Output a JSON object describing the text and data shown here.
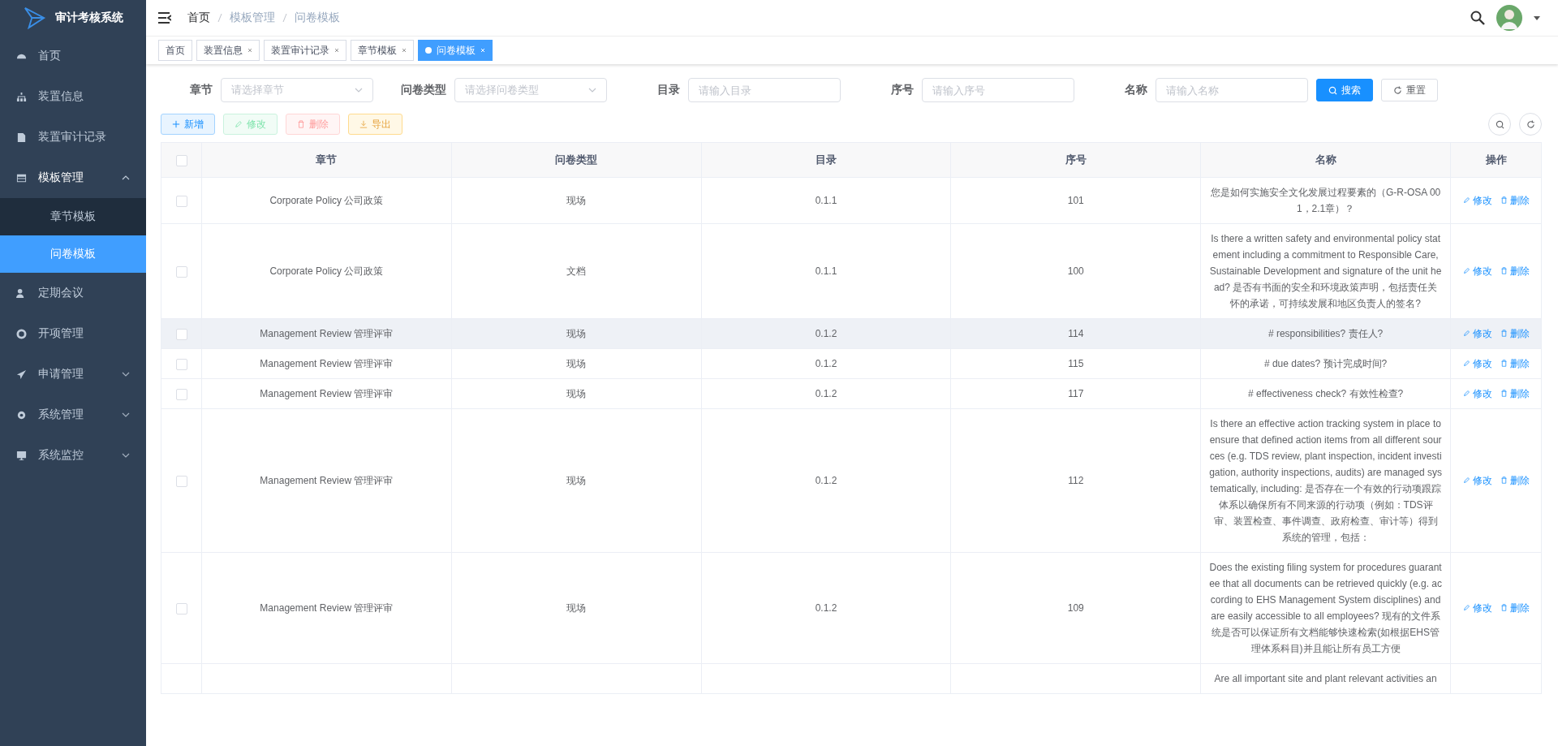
{
  "sidebar": {
    "title": "审计考核系统",
    "items": [
      {
        "label": "首页"
      },
      {
        "label": "装置信息"
      },
      {
        "label": "装置审计记录"
      },
      {
        "label": "模板管理",
        "expanded": true,
        "children": [
          {
            "label": "章节模板",
            "selected": false
          },
          {
            "label": "问卷模板",
            "selected": true
          }
        ]
      },
      {
        "label": "定期会议"
      },
      {
        "label": "开项管理"
      },
      {
        "label": "申请管理",
        "expanded": false
      },
      {
        "label": "系统管理",
        "expanded": false
      },
      {
        "label": "系统监控",
        "expanded": false
      }
    ]
  },
  "breadcrumb": [
    "首页",
    "模板管理",
    "问卷模板"
  ],
  "tabs": [
    {
      "label": "首页",
      "selected": false,
      "closable": false
    },
    {
      "label": "装置信息",
      "selected": false,
      "closable": true
    },
    {
      "label": "装置审计记录",
      "selected": false,
      "closable": true
    },
    {
      "label": "章节模板",
      "selected": false,
      "closable": true
    },
    {
      "label": "问卷模板",
      "selected": true,
      "closable": true
    }
  ],
  "filters": [
    {
      "label": "章节",
      "kind": "select",
      "placeholder": "请选择章节"
    },
    {
      "label": "问卷类型",
      "kind": "select",
      "placeholder": "请选择问卷类型"
    },
    {
      "label": "目录",
      "kind": "input",
      "placeholder": "请输入目录"
    },
    {
      "label": "序号",
      "kind": "input",
      "placeholder": "请输入序号"
    },
    {
      "label": "名称",
      "kind": "input",
      "placeholder": "请输入名称"
    }
  ],
  "search_button": "搜索",
  "reset_button": "重置",
  "toolbar": [
    {
      "label": "新增",
      "kind": "add",
      "disabled": false
    },
    {
      "label": "修改",
      "kind": "edit",
      "disabled": true
    },
    {
      "label": "删除",
      "kind": "delete",
      "disabled": true
    },
    {
      "label": "导出",
      "kind": "export",
      "disabled": false
    }
  ],
  "table": {
    "all_checked": false,
    "columns": [
      "章节",
      "问卷类型",
      "目录",
      "序号",
      "名称",
      "操作"
    ],
    "rows": [
      {
        "checked": false,
        "hovered": false,
        "chapter": "Corporate Policy 公司政策",
        "type": "现场",
        "catalog": "0.1.1",
        "number": "101",
        "name": "您是如何实施安全文化发展过程要素的（G-R-OSA 001，2.1章）？",
        "actions": [
          "修改",
          "删除"
        ]
      },
      {
        "checked": false,
        "hovered": false,
        "chapter": "Corporate Policy 公司政策",
        "type": "文档",
        "catalog": "0.1.1",
        "number": "100",
        "name": "Is there a written safety and environmental policy statement including a commitment to Responsible Care, Sustainable Development and signature of the unit head? 是否有书面的安全和环境政策声明，包括责任关怀的承诺，可持续发展和地区负责人的签名?",
        "actions": [
          "修改",
          "删除"
        ]
      },
      {
        "checked": false,
        "hovered": true,
        "chapter": "Management Review 管理评审",
        "type": "现场",
        "catalog": "0.1.2",
        "number": "114",
        "name": "# responsibilities? 责任人?",
        "actions": [
          "修改",
          "删除"
        ]
      },
      {
        "checked": false,
        "hovered": false,
        "chapter": "Management Review 管理评审",
        "type": "现场",
        "catalog": "0.1.2",
        "number": "115",
        "name": "# due dates? 预计完成时间?",
        "actions": [
          "修改",
          "删除"
        ]
      },
      {
        "checked": false,
        "hovered": false,
        "chapter": "Management Review 管理评审",
        "type": "现场",
        "catalog": "0.1.2",
        "number": "117",
        "name": "# effectiveness check? 有效性检查?",
        "actions": [
          "修改",
          "删除"
        ]
      },
      {
        "checked": false,
        "hovered": false,
        "chapter": "Management Review 管理评审",
        "type": "现场",
        "catalog": "0.1.2",
        "number": "112",
        "name": "Is there an effective action tracking system in place to ensure that defined action items from all different sources (e.g. TDS review, plant inspection, incident investigation, authority inspections, audits) are managed systematically, including: 是否存在一个有效的行动项跟踪体系以确保所有不同来源的行动项（例如：TDS评审、装置检查、事件调查、政府检查、审计等）得到系统的管理，包括：",
        "actions": [
          "修改",
          "删除"
        ]
      },
      {
        "checked": false,
        "hovered": false,
        "chapter": "Management Review 管理评审",
        "type": "现场",
        "catalog": "0.1.2",
        "number": "109",
        "name": "Does the existing filing system for procedures guarantee that all documents can be retrieved quickly (e.g. according to EHS Management System disciplines) and are easily accessible to all employees? 现有的文件系统是否可以保证所有文档能够快速检索(如根据EHS管理体系科目)并且能让所有员工方便",
        "actions": [
          "修改",
          "删除"
        ]
      },
      {
        "name": "Are all important site and plant relevant activities an"
      }
    ]
  }
}
